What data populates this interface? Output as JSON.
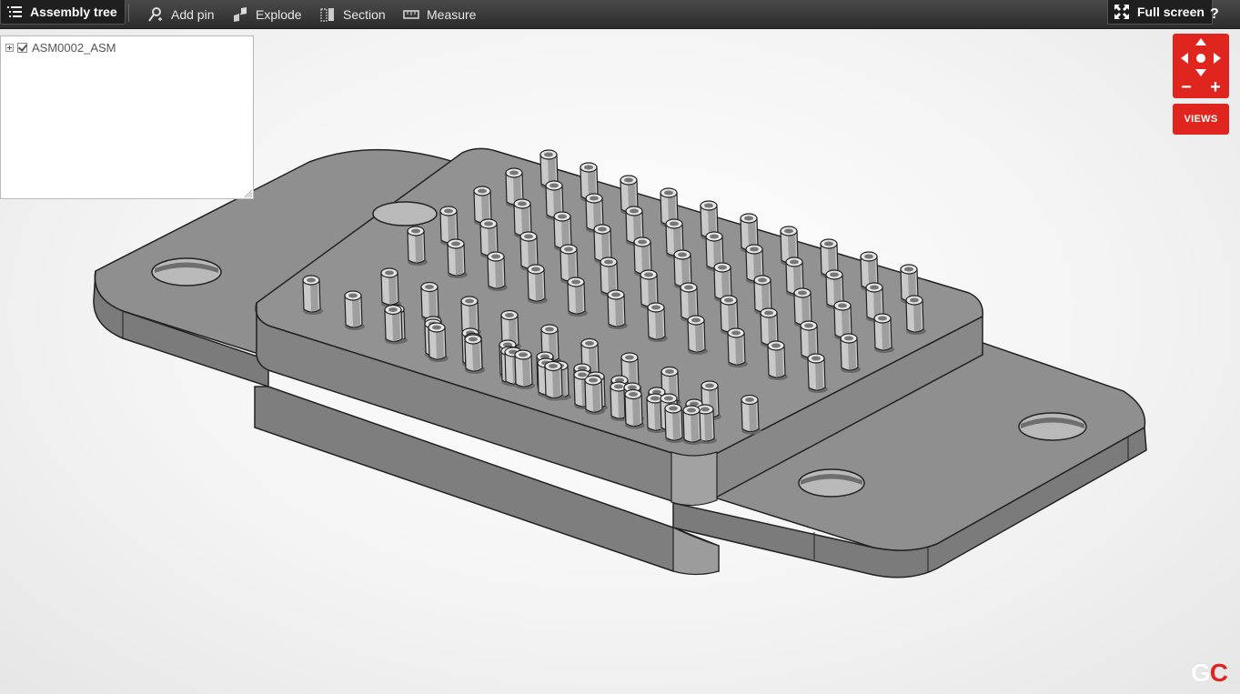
{
  "toolbar": {
    "assembly_tree": "Assembly tree",
    "add_pin": "Add pin",
    "explode": "Explode",
    "section": "Section",
    "measure": "Measure",
    "full_screen": "Full screen",
    "help": "?"
  },
  "tree": {
    "root_label": "ASM0002_ASM",
    "root_checked": true
  },
  "navigation": {
    "zoom_out": "−",
    "zoom_in": "+",
    "views_label": "VIEWS"
  },
  "logo": {
    "g": "G",
    "c": "C"
  },
  "colors": {
    "toolbar": "#333333",
    "accent": "#e0251f",
    "model": "#9a9a9a"
  }
}
